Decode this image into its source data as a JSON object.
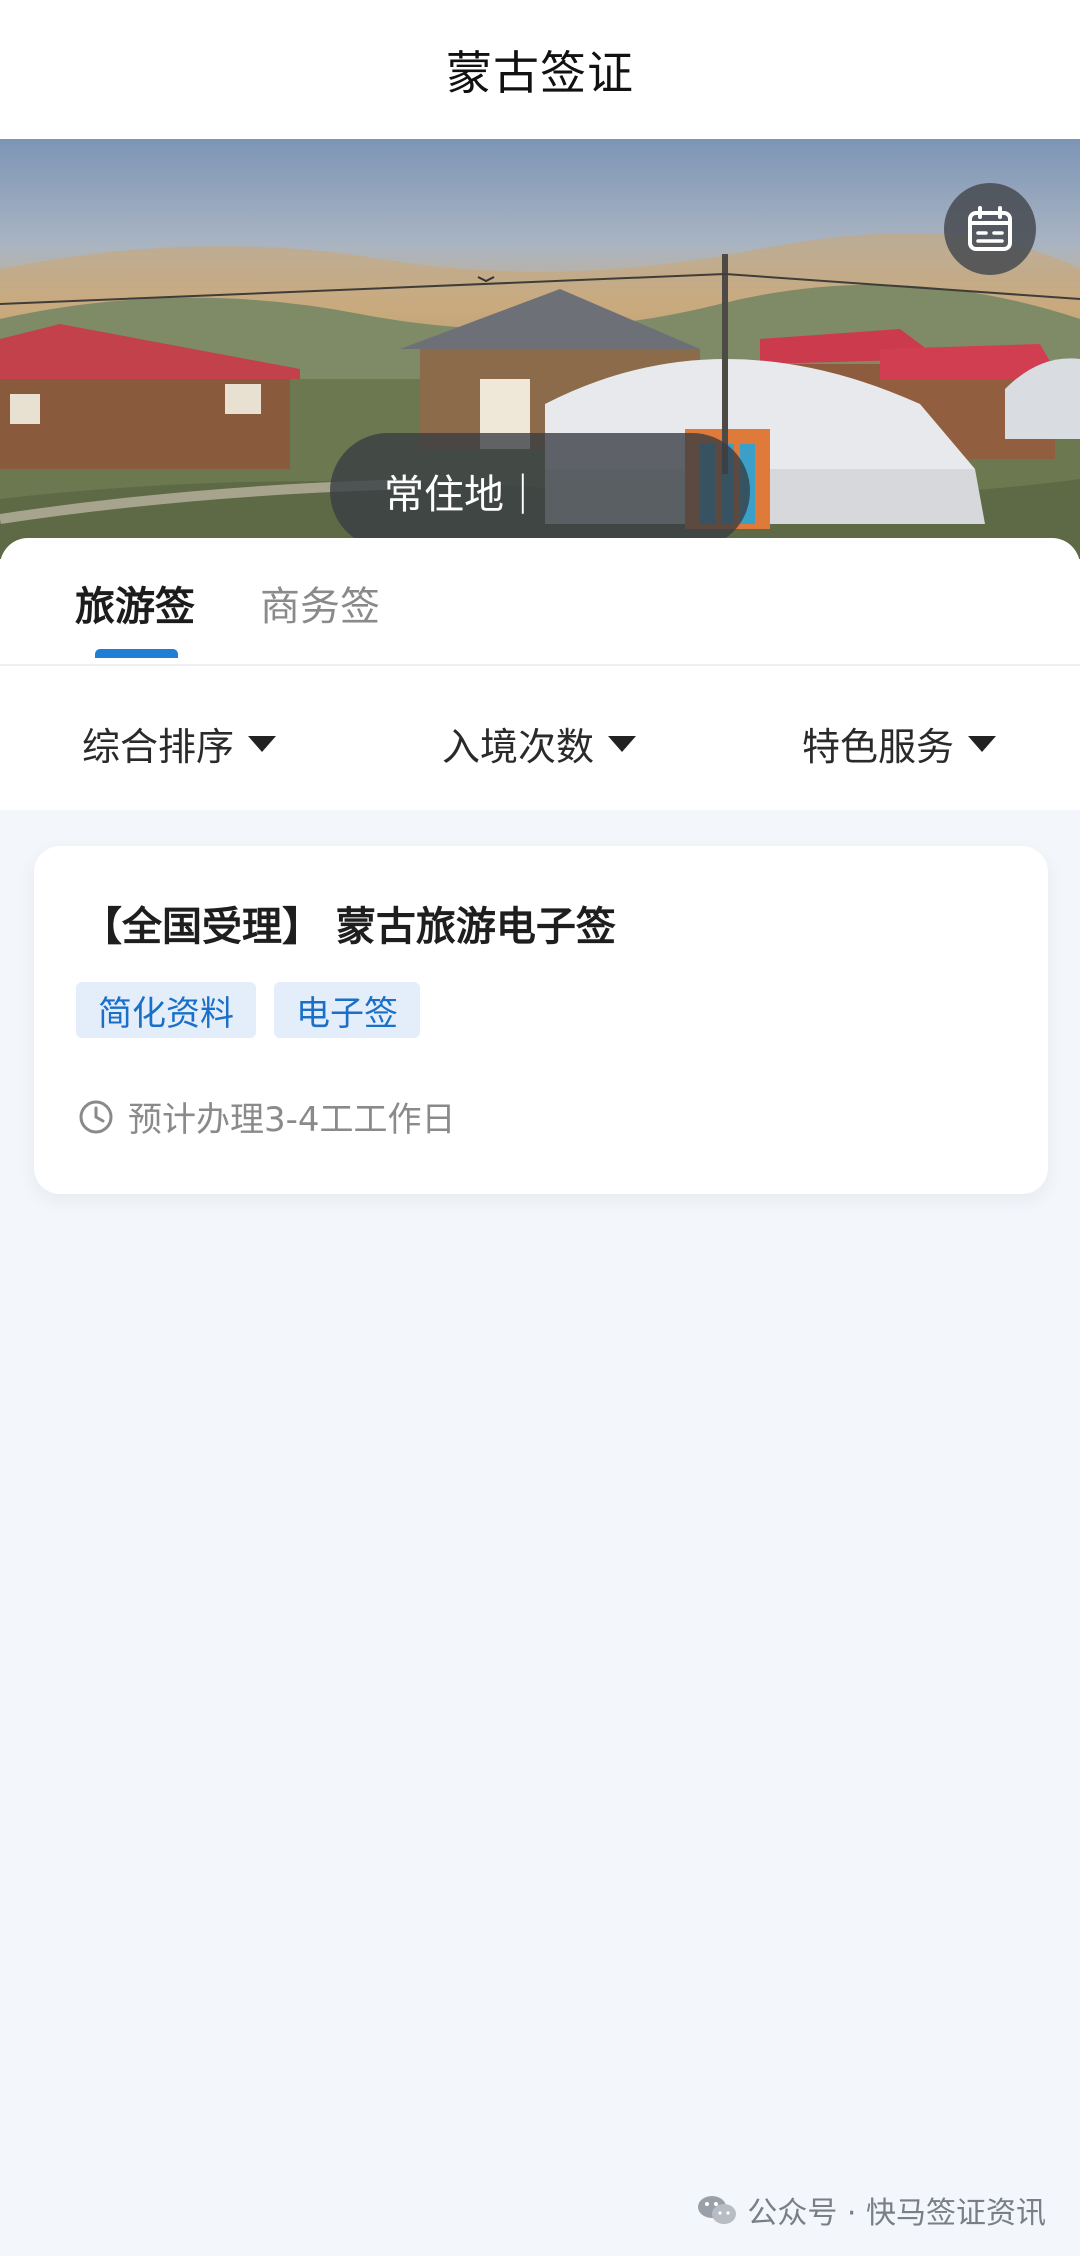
{
  "header": {
    "title": "蒙古签证"
  },
  "hero": {
    "location_label": "常住地",
    "location_caret": "|"
  },
  "tabs": [
    {
      "label": "旅游签",
      "active": true
    },
    {
      "label": "商务签",
      "active": false
    }
  ],
  "filters": [
    {
      "label": "综合排序"
    },
    {
      "label": "入境次数"
    },
    {
      "label": "特色服务"
    }
  ],
  "products": [
    {
      "title": "【全国受理】 蒙古旅游电子签",
      "tags": [
        "简化资料",
        "电子签"
      ],
      "eta": "预计办理3-4工工作日"
    }
  ],
  "watermark": {
    "text": "公众号 · 快马签证资讯"
  },
  "colors": {
    "accent": "#1f7fd6",
    "tag_bg": "#e4eefa",
    "tag_text": "#1a70c8",
    "page_bg": "#f3f6fa"
  },
  "icons": {
    "calendar": "calendar-icon",
    "clock": "clock-icon",
    "dropdown": "triangle-down-icon",
    "wechat": "wechat-icon"
  }
}
